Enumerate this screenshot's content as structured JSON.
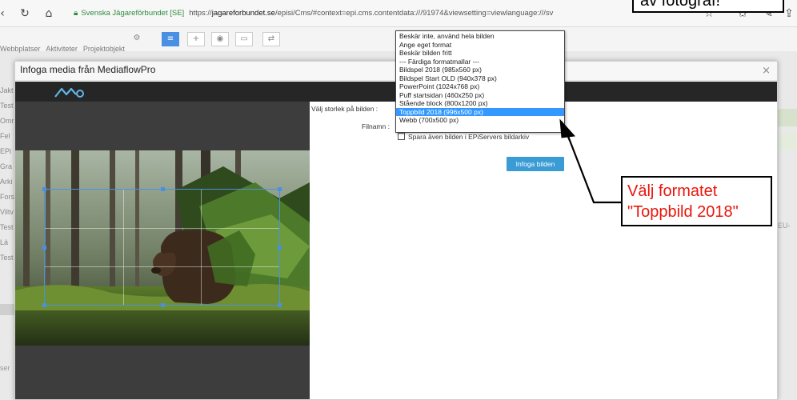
{
  "browser": {
    "back_icon": "back-arrow-icon",
    "reload_icon": "reload-icon",
    "home_icon": "home-icon",
    "site_name": "Svenska Jägareförbundet [SE]",
    "url_prefix": "https://",
    "url_domain": "jagareforbundet.se",
    "url_rest": "/episi/Cms/#context=epi.cms.contentdata:///91974&viewsetting=viewlanguage:///sv"
  },
  "cms": {
    "tabs": [
      "Webbplatser",
      "Aktiviteter",
      "Projektobjekt"
    ],
    "list_items": [
      "Jakt",
      "Test",
      "Omr",
      "Fel",
      "EPi",
      "Gra",
      "Arki",
      "Fors",
      "Viltv",
      "Test",
      "Lä",
      "Test"
    ],
    "right_text": "EU-",
    "bottom_left_text": "ser"
  },
  "dialog": {
    "title": "Infoga media från MediaflowPro",
    "close_label": "×",
    "size_label": "Välj storlek på bilden :",
    "filename_label": "Filnamn :",
    "checkbox_label": "Spara även bilden i EPiServers bildarkiv",
    "insert_button": "Infoga bilden"
  },
  "dropdown": {
    "options": [
      "Beskär inte, använd hela bilden",
      "Ange eget format",
      "Beskär bilden fritt",
      "--- Färdiga formatmallar ---",
      "Bildspel 2018 (985x560 px)",
      "Bildspel Start OLD (940x378 px)",
      "PowerPoint (1024x768 px)",
      "Puff startsidan (460x250 px)",
      "Stående block (800x1200 px)",
      "Toppbild 2018 (996x500 px)",
      "Webb (700x500 px)"
    ],
    "selected_index": 9
  },
  "annotations": {
    "top_callout": "av fotograf!",
    "callout_line1": "Välj formatet",
    "callout_line2": "\"Toppbild 2018\""
  },
  "colors": {
    "accent_blue": "#3a9bd5",
    "selection_blue": "#3399ff",
    "annotation_red": "#e8160c",
    "secure_green": "#2e8b3d"
  }
}
